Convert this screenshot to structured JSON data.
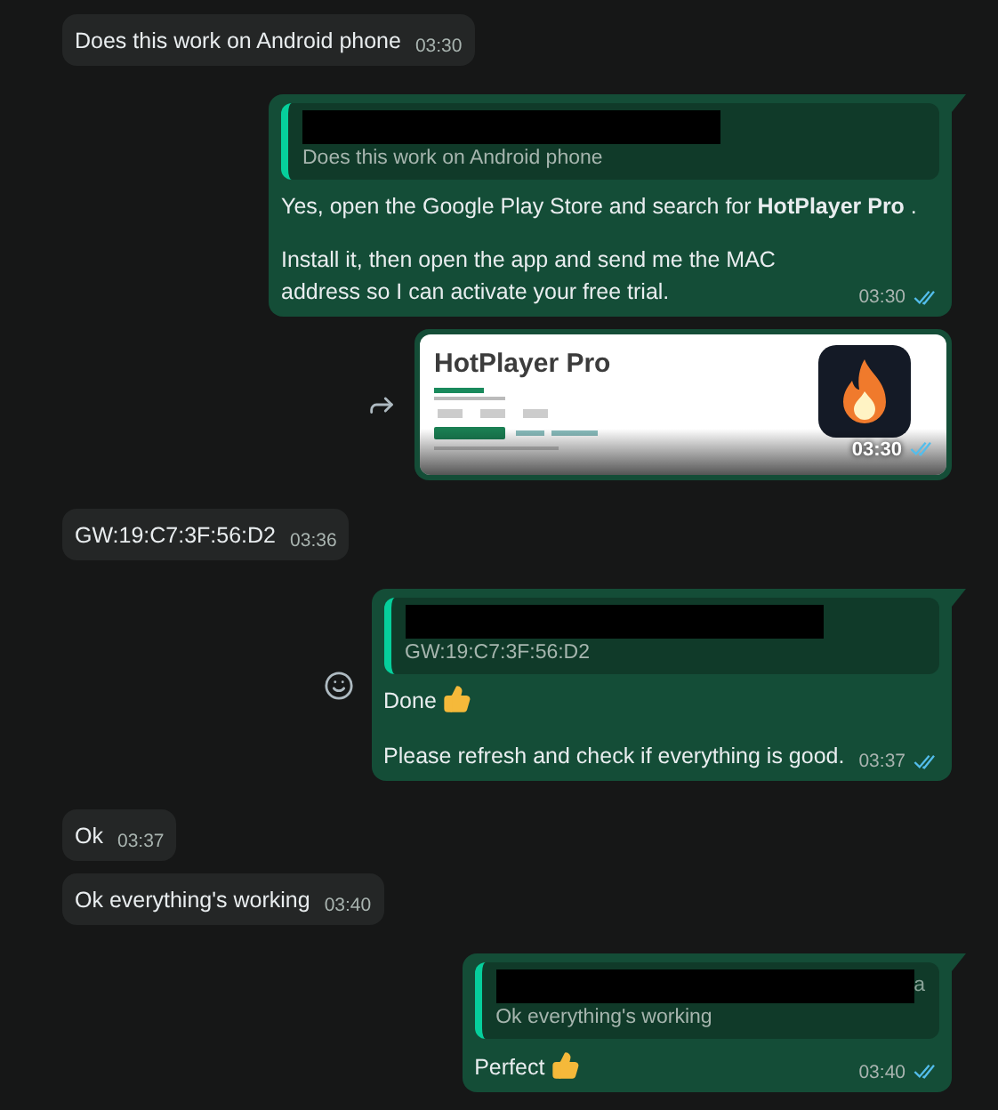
{
  "messages": [
    {
      "kind": "incoming",
      "paragraphs": [
        {
          "text": "Does this work on Android phone"
        }
      ],
      "time": "03:30"
    },
    {
      "kind": "outgoing",
      "quote": {
        "text": "Does this work on Android phone"
      },
      "paragraphs": [
        {
          "text": "Yes, open the Google Play Store and search for **HotPlayer Pro** ."
        },
        {
          "text": "Install it, then open the app and send me the MAC address so I can activate your free trial."
        }
      ],
      "time": "03:30",
      "read": true
    },
    {
      "kind": "image",
      "forward_button": true,
      "title": "HotPlayer Pro",
      "time": "03:30",
      "read": true
    },
    {
      "kind": "incoming",
      "paragraphs": [
        {
          "text": "GW:19:C7:3F:56:D2"
        }
      ],
      "time": "03:36"
    },
    {
      "kind": "outgoing",
      "react_button": true,
      "quote": {
        "text": "GW:19:C7:3F:56:D2"
      },
      "paragraphs": [
        {
          "text": "Done",
          "thumbs_up": true
        },
        {
          "text": "Please refresh and check if everything is good."
        }
      ],
      "time": "03:37",
      "read": true
    },
    {
      "kind": "incoming",
      "paragraphs": [
        {
          "text": "Ok"
        }
      ],
      "time": "03:37"
    },
    {
      "kind": "incoming",
      "paragraphs": [
        {
          "text": "Ok everything's working"
        }
      ],
      "time": "03:40"
    },
    {
      "kind": "outgoing",
      "quote": {
        "name_tail": "a",
        "text": "Ok everything's working"
      },
      "paragraphs": [
        {
          "text": "Perfect",
          "thumbs_up": true
        }
      ],
      "time": "03:40",
      "read": true
    }
  ]
}
